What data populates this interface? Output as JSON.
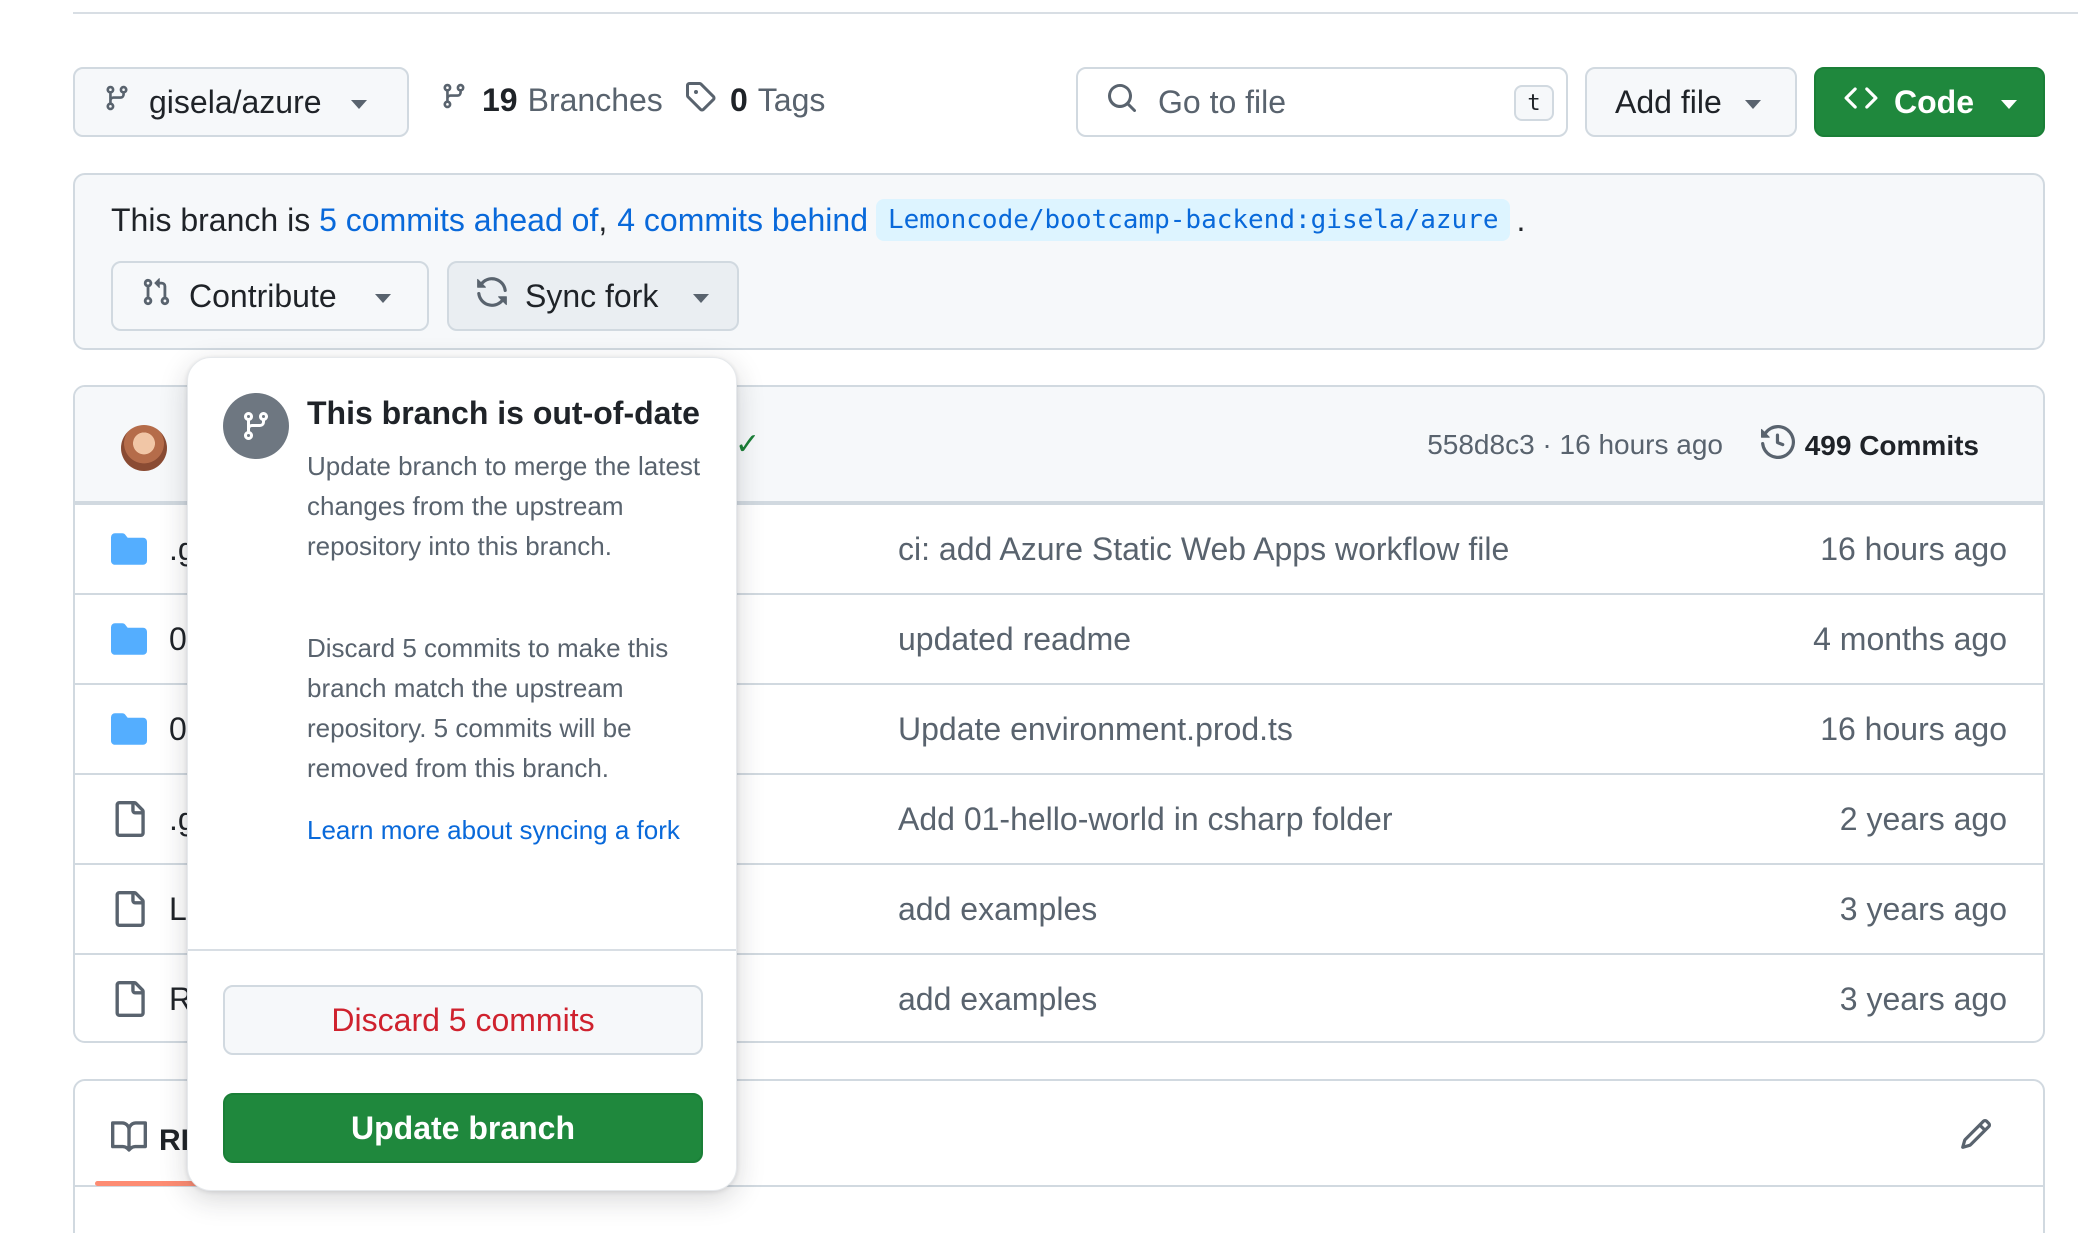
{
  "toolbar": {
    "branch_name": "gisela/azure",
    "branches_count": "19",
    "branches_label": "Branches",
    "tags_count": "0",
    "tags_label": "Tags",
    "search_placeholder": "Go to file",
    "search_shortcut": "t",
    "add_file_label": "Add file",
    "code_label": "Code"
  },
  "banner": {
    "prefix": "This branch is ",
    "ahead_link": "5 commits ahead of",
    "comma": ",",
    "behind_link": "4 commits behind",
    "upstream_ref": "Lemoncode/bootcamp-backend:gisela/azure",
    "period": ".",
    "contribute_label": "Contribute",
    "sync_fork_label": "Sync fork"
  },
  "latest_commit": {
    "hash_time": "558d8c3 · 16 hours ago",
    "commits_count_label": "499 Commits"
  },
  "files": [
    {
      "type": "folder",
      "name_visible": ".g",
      "message": "ci: add Azure Static Web Apps workflow file",
      "time": "16 hours ago"
    },
    {
      "type": "folder",
      "name_visible": "0",
      "message": "updated readme",
      "time": "4 months ago"
    },
    {
      "type": "folder",
      "name_visible": "0",
      "message": "Update environment.prod.ts",
      "time": "16 hours ago"
    },
    {
      "type": "file",
      "name_visible": ".g",
      "message": "Add 01-hello-world in csharp folder",
      "time": "2 years ago"
    },
    {
      "type": "file",
      "name_visible": "L",
      "message": "add examples",
      "time": "3 years ago"
    },
    {
      "type": "file",
      "name_visible": "R",
      "message": "add examples",
      "time": "3 years ago"
    }
  ],
  "readme": {
    "tab_label_visible": "RI"
  },
  "popover": {
    "title": "This branch is out-of-date",
    "paragraph_1": "Update branch to merge the latest changes from the upstream repository into this branch.",
    "paragraph_2": "Discard 5 commits to make this branch match the upstream repository. 5 commits will be removed from this branch.",
    "learn_more": "Learn more about syncing a fork",
    "discard_label": "Discard 5 commits",
    "update_label": "Update branch"
  },
  "colors": {
    "primary_green": "#1f883d",
    "link_blue": "#0969da",
    "danger_red": "#cf222e",
    "folder_blue": "#54aeff",
    "muted_text": "#59636e"
  }
}
